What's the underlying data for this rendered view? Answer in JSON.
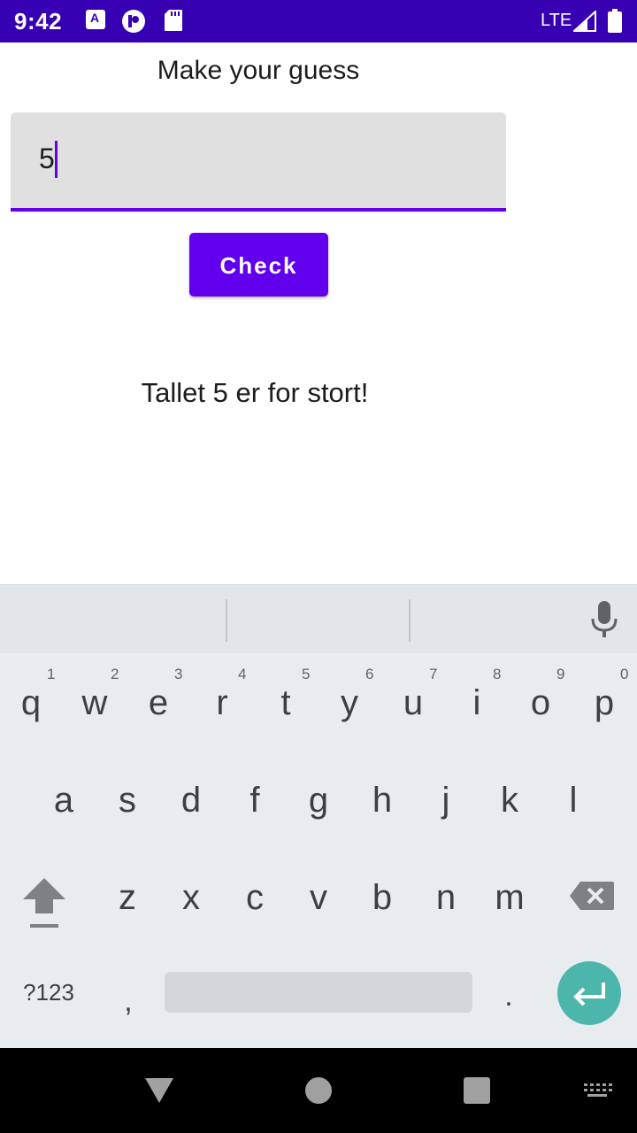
{
  "status_bar": {
    "time": "9:42",
    "network": "LTE",
    "icons": [
      "a-app-icon",
      "p-app-icon",
      "sd-card-icon",
      "signal-icon",
      "battery-icon"
    ],
    "background_color": "#3700b3"
  },
  "main": {
    "prompt": "Make your guess",
    "guess_input": {
      "value": "5"
    },
    "check_button": "Check",
    "result": "Tallet 5 er for stort!",
    "accent_color": "#6200ee"
  },
  "keyboard": {
    "row1": [
      {
        "letter": "q",
        "hint": "1"
      },
      {
        "letter": "w",
        "hint": "2"
      },
      {
        "letter": "e",
        "hint": "3"
      },
      {
        "letter": "r",
        "hint": "4"
      },
      {
        "letter": "t",
        "hint": "5"
      },
      {
        "letter": "y",
        "hint": "6"
      },
      {
        "letter": "u",
        "hint": "7"
      },
      {
        "letter": "i",
        "hint": "8"
      },
      {
        "letter": "o",
        "hint": "9"
      },
      {
        "letter": "p",
        "hint": "0"
      }
    ],
    "row2": [
      "a",
      "s",
      "d",
      "f",
      "g",
      "h",
      "j",
      "k",
      "l"
    ],
    "row3": [
      "z",
      "x",
      "c",
      "v",
      "b",
      "n",
      "m"
    ],
    "symbols_key": "?123",
    "comma_key": ",",
    "period_key": ".",
    "enter_color": "#4db6ac",
    "icons": [
      "mic-icon",
      "shift-icon",
      "backspace-icon",
      "enter-icon"
    ]
  },
  "nav_bar": {
    "icons": [
      "back-icon",
      "home-icon",
      "recents-icon",
      "keyboard-switch-icon"
    ]
  }
}
